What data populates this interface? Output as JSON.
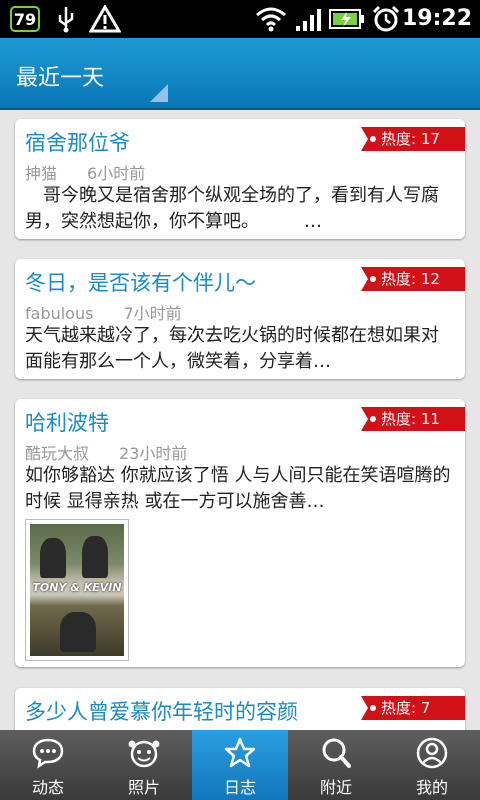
{
  "status_bar": {
    "battery_level": "79",
    "time": "19:22"
  },
  "header": {
    "title": "最近一天"
  },
  "feed": [
    {
      "title": "宿舍那位爷",
      "author": "抻猫",
      "time": "6小时前",
      "heat": "热度: 17",
      "body": "　哥今晚又是宿舍那个纵观全场的了，看到有人写腐男，突然想起你，你不算吧。　　　…"
    },
    {
      "title": "冬日，是否该有个伴儿～",
      "author": "fabulous",
      "time": "7小时前",
      "heat": "热度: 12",
      "body": "天气越来越冷了，每次去吃火锅的时候都在想如果对面能有那么一个人，微笑着，分享着…"
    },
    {
      "title": "哈利波特",
      "author": "酷玩大叔",
      "time": "23小时前",
      "heat": "热度: 11",
      "body": "如你够豁达 你就应该了悟 人与人间只能在笑语喧腾的时候 显得亲热 或在一方可以施舍善…",
      "image_caption": "TONY & KEVIN"
    },
    {
      "title": "多少人曾爱慕你年轻时的容颜",
      "heat": "热度: 7"
    }
  ],
  "tabs": [
    {
      "label": "动态",
      "icon": "chat-bubble-icon",
      "active": false
    },
    {
      "label": "照片",
      "icon": "photo-face-icon",
      "active": false
    },
    {
      "label": "日志",
      "icon": "star-icon",
      "active": true
    },
    {
      "label": "附近",
      "icon": "search-icon",
      "active": false
    },
    {
      "label": "我的",
      "icon": "user-icon",
      "active": false
    }
  ]
}
